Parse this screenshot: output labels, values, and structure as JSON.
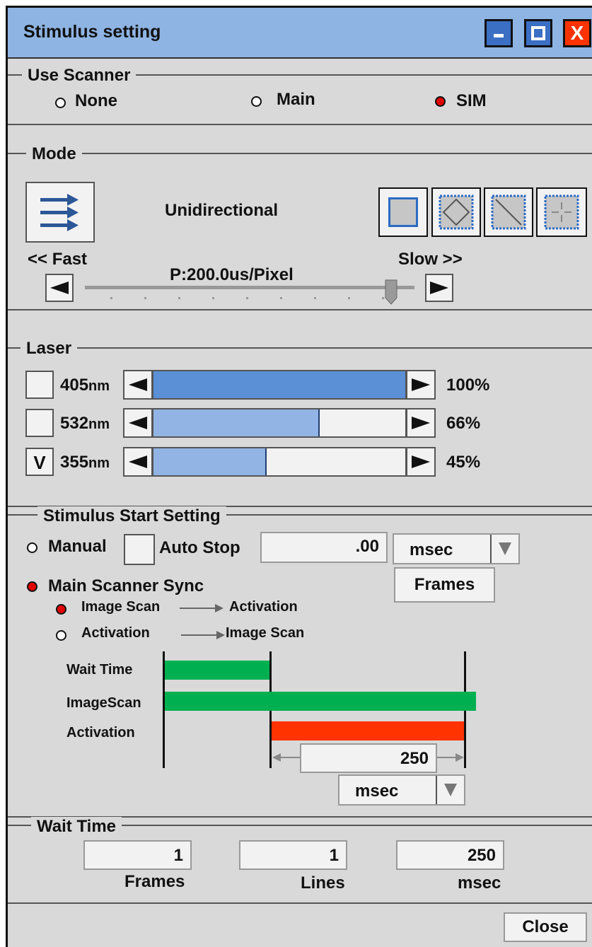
{
  "window": {
    "title": "Stimulus setting",
    "close_glyph": "X"
  },
  "use_scanner": {
    "legend": "Use Scanner",
    "options": [
      {
        "label": "None",
        "selected": false
      },
      {
        "label": "Main",
        "selected": false
      },
      {
        "label": "SIM",
        "selected": true
      }
    ]
  },
  "mode": {
    "legend": "Mode",
    "scan_direction": "Unidirectional",
    "scan_icon": "unidirectional-arrows-icon",
    "roi_shapes": [
      "rectangle-roi-icon",
      "rotated-rectangle-roi-icon",
      "line-roi-icon",
      "point-roi-icon"
    ],
    "fast_label": "<< Fast",
    "slow_label": "Slow >>",
    "speed_value": "P:200.0us/Pixel",
    "speed_level": 0.93
  },
  "laser": {
    "legend": "Laser",
    "unit": "nm",
    "lines": [
      {
        "wavelength": "405",
        "checked": false,
        "check_glyph": "",
        "percent": 100,
        "percent_label": "100%",
        "color": "#5b8fd6"
      },
      {
        "wavelength": "532",
        "checked": false,
        "check_glyph": "",
        "percent": 66,
        "percent_label": "66%",
        "color": "#92b4e4"
      },
      {
        "wavelength": "355",
        "checked": true,
        "check_glyph": "V",
        "percent": 45,
        "percent_label": "45%",
        "color": "#92b4e4"
      }
    ]
  },
  "stimulus_start": {
    "legend": "Stimulus Start Setting",
    "manual_label": "Manual",
    "manual_selected": false,
    "auto_stop_label": "Auto Stop",
    "auto_stop_value": ".00",
    "unit_select": "msec",
    "frames_button": "Frames",
    "sync_label": "Main Scanner Sync",
    "sync_selected": true,
    "order_options": [
      {
        "from": "Image Scan",
        "to": "Activation",
        "selected": true
      },
      {
        "from": "Activation",
        "to": "Image Scan",
        "selected": false
      }
    ],
    "timeline": {
      "rows": [
        "Wait Time",
        "ImageScan",
        "Activation"
      ],
      "colors": {
        "wait": "#00b050",
        "scan": "#00b050",
        "activation": "#ff3300"
      },
      "duration_value": "250",
      "duration_unit": "msec"
    }
  },
  "wait_time": {
    "legend": "Wait Time",
    "fields": [
      {
        "value": "1",
        "label": "Frames"
      },
      {
        "value": "1",
        "label": "Lines"
      },
      {
        "value": "250",
        "label": "msec"
      }
    ]
  },
  "footer": {
    "close_button": "Close"
  }
}
